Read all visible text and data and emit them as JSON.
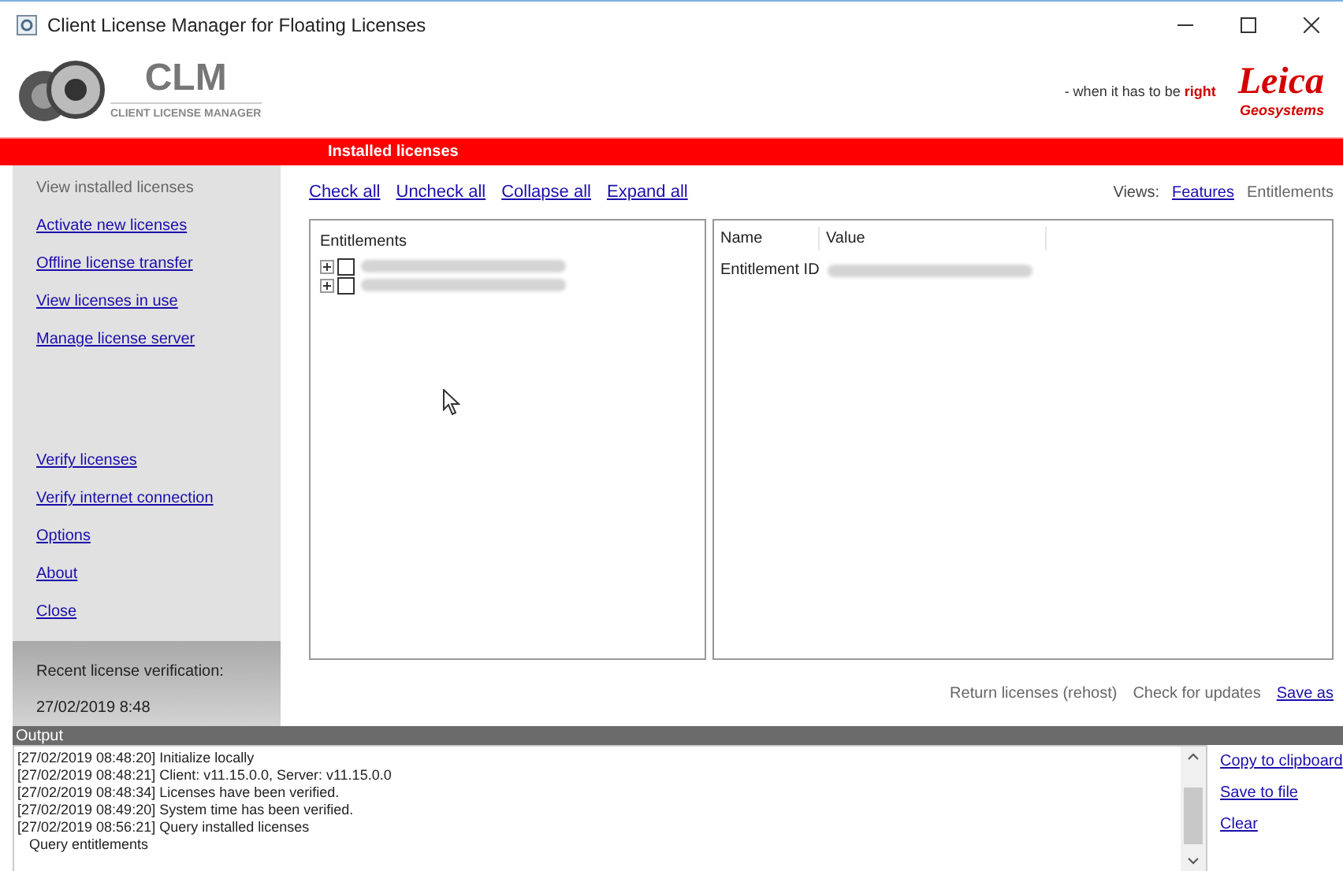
{
  "window": {
    "title": "Client License Manager for Floating Licenses"
  },
  "header": {
    "logo_title": "CLM",
    "logo_subtitle": "CLIENT LICENSE MANAGER",
    "slogan": "- when it has to be **right**",
    "brand": "Leica",
    "brand_sub": "Geosystems"
  },
  "section_title": "Installed licenses",
  "sidebar": {
    "items": [
      {
        "label": "View installed licenses",
        "selected": true
      },
      {
        "label": "Activate new licenses",
        "selected": false
      },
      {
        "label": "Offline license transfer",
        "selected": false
      },
      {
        "label": "View licenses in use",
        "selected": false
      },
      {
        "label": "Manage license server",
        "selected": false
      }
    ],
    "tools": [
      "Verify licenses",
      "Verify internet connection",
      "Options",
      "About",
      "Close"
    ],
    "verification_label": "Recent license verification:",
    "verification_date": "27/02/2019 8:48"
  },
  "toolbar": [
    "Check all",
    "Uncheck all",
    "Collapse all",
    "Expand all"
  ],
  "views": {
    "label": "Views:",
    "options": [
      {
        "label": "Features",
        "selected": false
      },
      {
        "label": "Entitlements",
        "selected": true
      }
    ]
  },
  "tree": {
    "heading": "Entitlements",
    "items": [
      {
        "checked": false,
        "expanded": false
      },
      {
        "checked": false,
        "expanded": false
      }
    ]
  },
  "details": {
    "columns": [
      "Name",
      "Value"
    ],
    "rows": [
      {
        "name": "Entitlement ID"
      }
    ]
  },
  "actions": [
    {
      "label": "Return licenses (rehost)",
      "disabled": true
    },
    {
      "label": "Check for updates",
      "disabled": true
    },
    {
      "label": "Save as",
      "disabled": false
    }
  ],
  "output": {
    "title": "Output",
    "lines": [
      "[27/02/2019 08:48:20] Initialize locally",
      "[27/02/2019 08:48:21] Client: v11.15.0.0, Server: v11.15.0.0",
      "[27/02/2019 08:48:34] Licenses have been verified.",
      "[27/02/2019 08:49:20] System time has been verified.",
      "[27/02/2019 08:56:21] Query installed licenses",
      "   Query entitlements"
    ],
    "links": [
      "Copy to clipboard",
      "Save to file",
      "Clear"
    ]
  }
}
